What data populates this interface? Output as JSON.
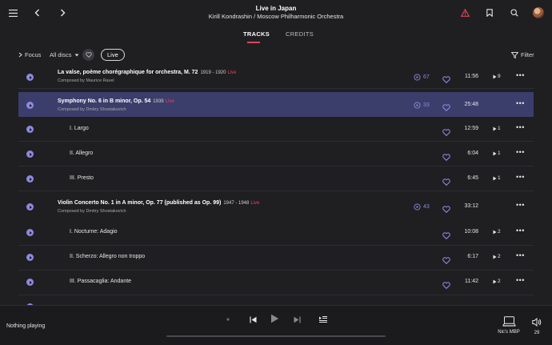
{
  "header": {
    "album_title": "Live in Japan",
    "album_artist": "Kirill Kondrashin / Moscow Philharmonic Orchestra"
  },
  "tabs": [
    {
      "label": "TRACKS",
      "active": true
    },
    {
      "label": "CREDITS",
      "active": false
    }
  ],
  "filterbar": {
    "focus_label": "Focus",
    "discs_label": "All discs",
    "live_label": "Live",
    "filter_label": "Filter"
  },
  "works": [
    {
      "title": "La valse, poème chorégraphique for orchestra, M. 72",
      "years": "1919 - 1920",
      "live": "Live",
      "composer": "Composed by Maurice Ravel",
      "count": "67",
      "duration": "11:56",
      "performances": "9",
      "selected": false
    },
    {
      "title": "Symphony No. 6 in B minor, Op. 54",
      "years": "1939",
      "live": "Live",
      "composer": "Composed by Dmitry Shostakovich",
      "count": "33",
      "duration": "25:48",
      "performances": "",
      "selected": true
    },
    {
      "title": "Violin Concerto No. 1 in A minor, Op. 77 (published as Op. 99)",
      "years": "1947 - 1948",
      "live": "Live",
      "composer": "Composed by Dmitry Shostakovich",
      "count": "43",
      "duration": "33:12",
      "performances": "",
      "selected": false
    }
  ],
  "movements": [
    {
      "title": "I. Largo",
      "duration": "12:59",
      "performances": "1"
    },
    {
      "title": "II. Allegro",
      "duration": "6:04",
      "performances": "1"
    },
    {
      "title": "III. Presto",
      "duration": "6:45",
      "performances": "1"
    },
    {
      "title": "I. Nocturne: Adagio",
      "duration": "10:08",
      "performances": "2"
    },
    {
      "title": "II. Scherzo: Allegro non troppo",
      "duration": "6:17",
      "performances": "2"
    },
    {
      "title": "III. Passacaglia: Andante",
      "duration": "11:42",
      "performances": "2"
    }
  ],
  "player": {
    "status": "Nothing playing",
    "device": "Nic's MBP",
    "volume": "29"
  },
  "colors": {
    "accent": "#8d89e0",
    "live": "#e0455a",
    "warning": "#e0455a",
    "selected_row": "#3b3e6b",
    "background": "#1f1f22"
  }
}
